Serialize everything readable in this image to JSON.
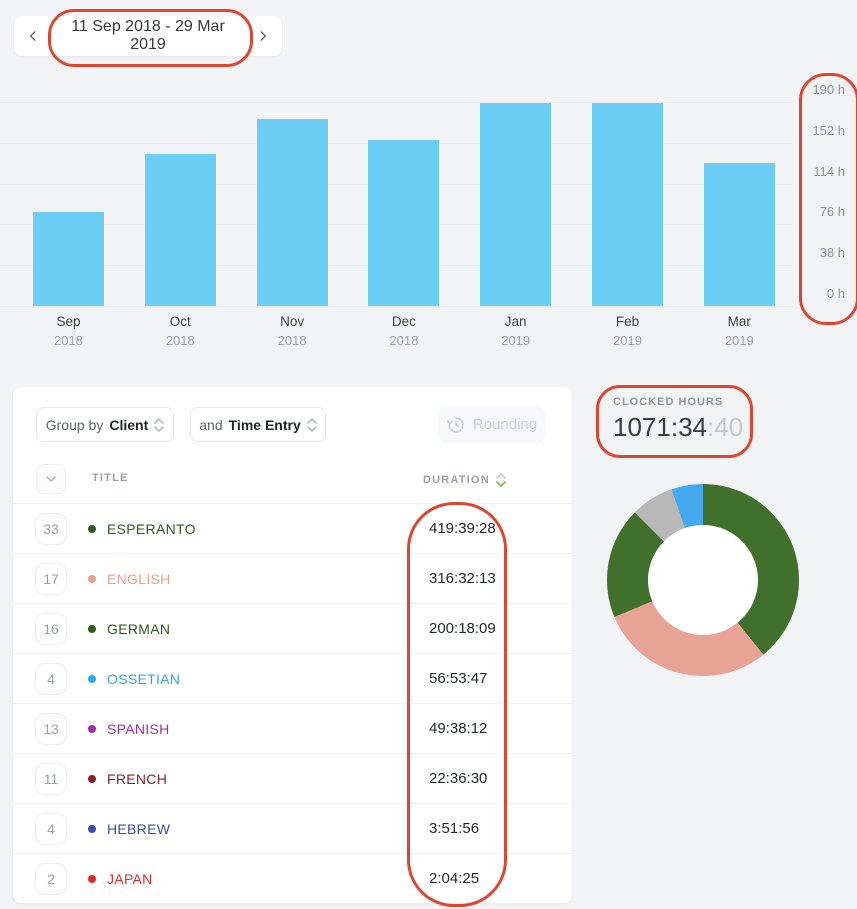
{
  "colors": {
    "annotation": "#df4632",
    "bar": "#6dcef5",
    "sort_active": "#72bf44"
  },
  "date_nav": {
    "label": "11 Sep 2018 - 29 Mar 2019"
  },
  "chart_data": [
    {
      "type": "bar",
      "categories": [
        "Sep",
        "Oct",
        "Nov",
        "Dec",
        "Jan",
        "Feb",
        "Mar"
      ],
      "category_years": [
        "2018",
        "2018",
        "2018",
        "2018",
        "2019",
        "2019",
        "2019"
      ],
      "values": [
        88,
        142,
        174,
        155,
        189,
        189,
        133
      ],
      "unit": "h",
      "ylim": [
        0,
        190
      ],
      "yticks": [
        190,
        152,
        114,
        76,
        38,
        0
      ],
      "ytick_labels": [
        "190 h",
        "152 h",
        "114 h",
        "76 h",
        "38 h",
        "0 h"
      ],
      "bar_color": "#6dcef5",
      "grid": true,
      "legend": false
    },
    {
      "type": "pie",
      "style": "donut",
      "series": [
        {
          "name": "ESPERANTO",
          "value": 419.66,
          "color": "#41702c"
        },
        {
          "name": "ENGLISH",
          "value": 316.54,
          "color": "#e7a396"
        },
        {
          "name": "GERMAN",
          "value": 200.3,
          "color": "#41702c"
        },
        {
          "name": "OTHER",
          "value": 78.18,
          "color": "#b8b8b8"
        },
        {
          "name": "OSSETIAN",
          "value": 56.9,
          "color": "#45a9ef"
        }
      ]
    }
  ],
  "filters": {
    "group_by_prefix": "Group by",
    "group_by_value": "Client",
    "and_prefix": "and",
    "and_value": "Time Entry",
    "rounding_label": "Rounding"
  },
  "summary": {
    "label": "CLOCKED HOURS",
    "main": "1071:34",
    "secondary": ":40"
  },
  "table": {
    "headers": {
      "title": "TITLE",
      "duration": "DURATION"
    },
    "rows": [
      {
        "count": "33",
        "name": "ESPERANTO",
        "color": "#2f5a1d",
        "duration": "419:39:28"
      },
      {
        "count": "17",
        "name": "ENGLISH",
        "color": "#e8a093",
        "duration": "316:32:13"
      },
      {
        "count": "16",
        "name": "GERMAN",
        "color": "#2f5a1d",
        "duration": "200:18:09"
      },
      {
        "count": "4",
        "name": "OSSETIAN",
        "color": "#2aa7f4",
        "duration": "56:53:47"
      },
      {
        "count": "13",
        "name": "SPANISH",
        "color": "#9d2bac",
        "duration": "49:38:12"
      },
      {
        "count": "11",
        "name": "FRENCH",
        "color": "#8e1d23",
        "duration": "22:36:30"
      },
      {
        "count": "4",
        "name": "HEBREW",
        "color": "#3a4bb5",
        "duration": "3:51:56"
      },
      {
        "count": "2",
        "name": "JAPAN",
        "color": "#e02a2a",
        "duration": "2:04:25"
      }
    ]
  }
}
